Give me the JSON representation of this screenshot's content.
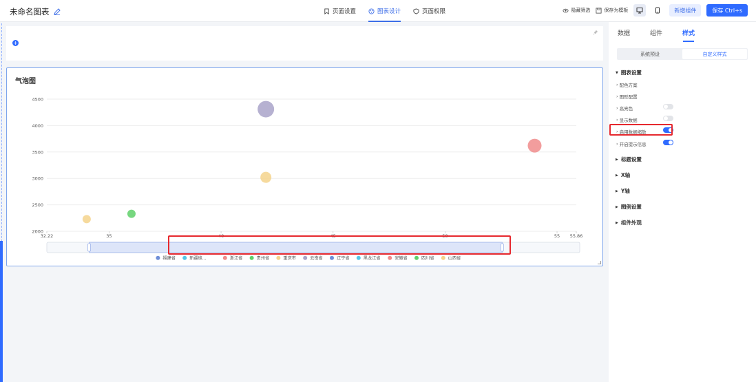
{
  "header": {
    "title": "未命名图表",
    "tabs": [
      {
        "label": "页面设置",
        "icon": "bookmark-icon",
        "active": false
      },
      {
        "label": "图表设计",
        "icon": "palette-icon",
        "active": true
      },
      {
        "label": "页面权限",
        "icon": "shield-icon",
        "active": false
      }
    ],
    "hide_filter_label": "隐藏筛选",
    "save_template_label": "保存为模板",
    "add_component_label": "新增组件",
    "save_label": "保存 Ctrl+s"
  },
  "chart": {
    "title": "气泡图",
    "accent_color": "#7ea6ec"
  },
  "chart_data": {
    "type": "scatter",
    "title": "气泡图",
    "xlim": [
      32.22,
      55.86
    ],
    "ylim": [
      2000,
      4500
    ],
    "x_ticks": [
      "32.22",
      "35",
      "40",
      "45",
      "50",
      "55",
      "55.86"
    ],
    "y_ticks": [
      "4500",
      "4000",
      "3500",
      "3000",
      "2500",
      "2000"
    ],
    "grid": true,
    "legend_placement": "bottom",
    "data_zoom": {
      "start": 0.08,
      "end": 0.86
    },
    "series": [
      {
        "name": "福建省",
        "color": "#6f8fd8",
        "points": []
      },
      {
        "name": "新疆维...",
        "color": "#54c6e8",
        "points": []
      },
      {
        "name": "浙江省",
        "color": "#f08c8c",
        "points": [
          {
            "x": 54.0,
            "y": 3620,
            "size": 10
          }
        ]
      },
      {
        "name": "贵州省",
        "color": "#5fd06a",
        "points": [
          {
            "x": 36.0,
            "y": 2330,
            "size": 6
          }
        ]
      },
      {
        "name": "重庆市",
        "color": "#f5d38c",
        "points": [
          {
            "x": 42.0,
            "y": 3020,
            "size": 8
          },
          {
            "x": 34.0,
            "y": 2230,
            "size": 6
          }
        ]
      },
      {
        "name": "云南省",
        "color": "#a9a3c9",
        "points": [
          {
            "x": 42.0,
            "y": 4310,
            "size": 12
          }
        ]
      },
      {
        "name": "辽宁省",
        "color": "#6f8fd8",
        "points": []
      },
      {
        "name": "黑龙江省",
        "color": "#54c6e8",
        "points": []
      },
      {
        "name": "安徽省",
        "color": "#f08c8c",
        "points": []
      },
      {
        "name": "四川省",
        "color": "#5fd06a",
        "points": []
      },
      {
        "name": "山西省",
        "color": "#f5d38c",
        "points": []
      }
    ]
  },
  "panel": {
    "tabs": [
      "数据",
      "组件",
      "样式"
    ],
    "active_tab": "样式",
    "segments": [
      "系统预设",
      "自定义样式"
    ],
    "active_segment": "自定义样式",
    "chart_settings": "图表设置",
    "rows": [
      {
        "label": "配色方案",
        "toggle": null
      },
      {
        "label": "图形配置",
        "toggle": null
      },
      {
        "label": "高亮色",
        "toggle": "off"
      },
      {
        "label": "显示数据",
        "toggle": "off"
      },
      {
        "label": "启用数据缩放",
        "toggle": "on"
      },
      {
        "label": "开启提示信息",
        "toggle": "on"
      }
    ],
    "sections": [
      "标题设置",
      "X轴",
      "Y轴",
      "图例设置",
      "组件外观"
    ]
  }
}
